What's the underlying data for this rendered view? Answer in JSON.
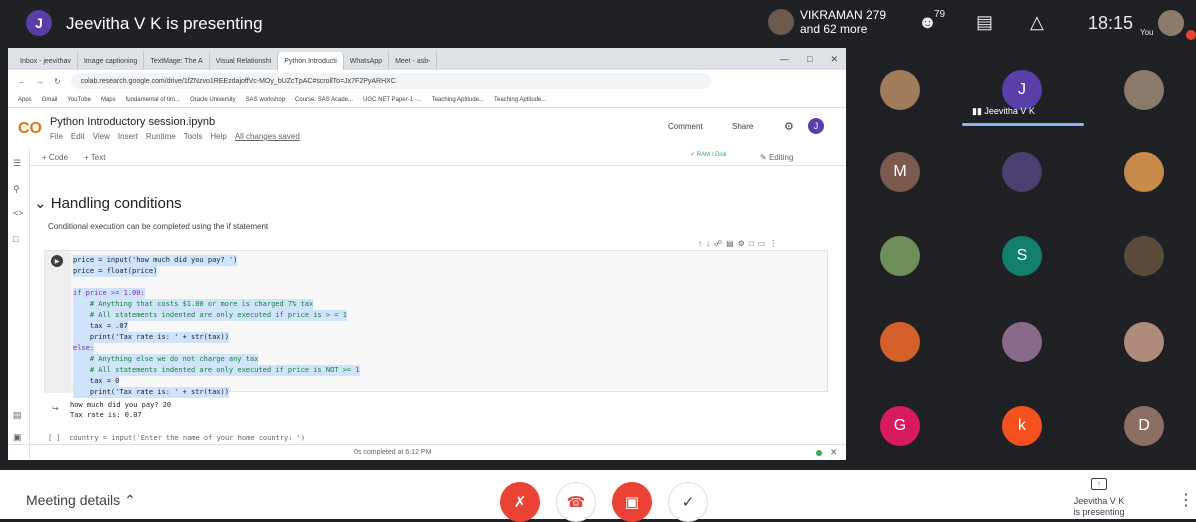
{
  "meet": {
    "presenter_initial": "J",
    "presenting_title": "Jeevitha V K is presenting",
    "viewer_name": "VIKRAMAN 279",
    "viewer_more": "and 62 more",
    "people_count": "79",
    "time": "18:15",
    "you_label": "You"
  },
  "browser": {
    "tabs": [
      "Inbox - jeevithav",
      "Image captioning",
      "TextMage: The A",
      "Visual Relationshi",
      "Python Introducti",
      "WhatsApp",
      "Meet - asb-"
    ],
    "url": "colab.research.google.com/drive/1fZNzvo1REEzdajoffVc-MOy_bUZcTpAC#scrollTo=Jx7F2PyARHXC",
    "bookmarks": [
      "Apps",
      "Gmail",
      "YouTube",
      "Maps",
      "fundamental of tim...",
      "Oracle University",
      "SAS workshop",
      "Course: SAS Acade...",
      "UGC NET Paper-1 -...",
      "Teaching Aptitude...",
      "Teaching Aptitude..."
    ]
  },
  "colab": {
    "logo": "CO",
    "title": "Python Introductory session.ipynb",
    "menu": [
      "File",
      "Edit",
      "View",
      "Insert",
      "Runtime",
      "Tools",
      "Help"
    ],
    "saved": "All changes saved",
    "comment": "Comment",
    "share": "Share",
    "user_initial": "J",
    "add_code": "+ Code",
    "add_text": "+ Text",
    "ram": "RAM",
    "disk": "Disk",
    "editing": "Editing",
    "section_heading": "Handling conditions",
    "section_text": "Conditional execution can be completed using the if statement",
    "output_line1": "how much did you pay? 20",
    "output_line2": "Tax rate is: 0.07",
    "next_cell": "[ ]  country = input('Enter the name of your home country: ')",
    "status": "0s   completed at 6:12 PM"
  },
  "code_lines": [
    "price = input('how much did you pay? ')",
    "price = float(price)",
    "",
    "if price >= 1.00:",
    "    # Anything that costs $1.00 or more is charged 7% tax",
    "    # All statements indented are only executed if price is > = 1",
    "    tax = .07",
    "    print('Tax rate is: ' + str(tax))",
    "else:",
    "    # Anything else we do not charge any tax",
    "    # All statements indented are only executed if price is NOT >= 1",
    "    tax = 0",
    "    print('Tax rate is: ' + str(tax))"
  ],
  "participants": {
    "presenter_name": "Jeevitha V K",
    "tiles": [
      {
        "initial": "",
        "color": "#a07c5a"
      },
      {
        "initial": "J",
        "color": "#5b3fa8"
      },
      {
        "initial": "",
        "color": "#8a7a6a"
      },
      {
        "initial": "M",
        "color": "#7d5a50"
      },
      {
        "initial": "",
        "color": "#4a3f6e"
      },
      {
        "initial": "",
        "color": "#c78a4a"
      },
      {
        "initial": "",
        "color": "#6f8f5a"
      },
      {
        "initial": "S",
        "color": "#137f6e"
      },
      {
        "initial": "",
        "color": "#5a4a3a"
      },
      {
        "initial": "",
        "color": "#d4602a"
      },
      {
        "initial": "",
        "color": "#8a6a8a"
      },
      {
        "initial": "",
        "color": "#b08a7a"
      },
      {
        "initial": "G",
        "color": "#d81b60"
      },
      {
        "initial": "k",
        "color": "#f4511e"
      },
      {
        "initial": "D",
        "color": "#8d6e63"
      }
    ]
  },
  "bottom": {
    "meeting_details": "Meeting details",
    "presenting_name": "Jeevitha V K",
    "presenting_status": "is presenting"
  }
}
